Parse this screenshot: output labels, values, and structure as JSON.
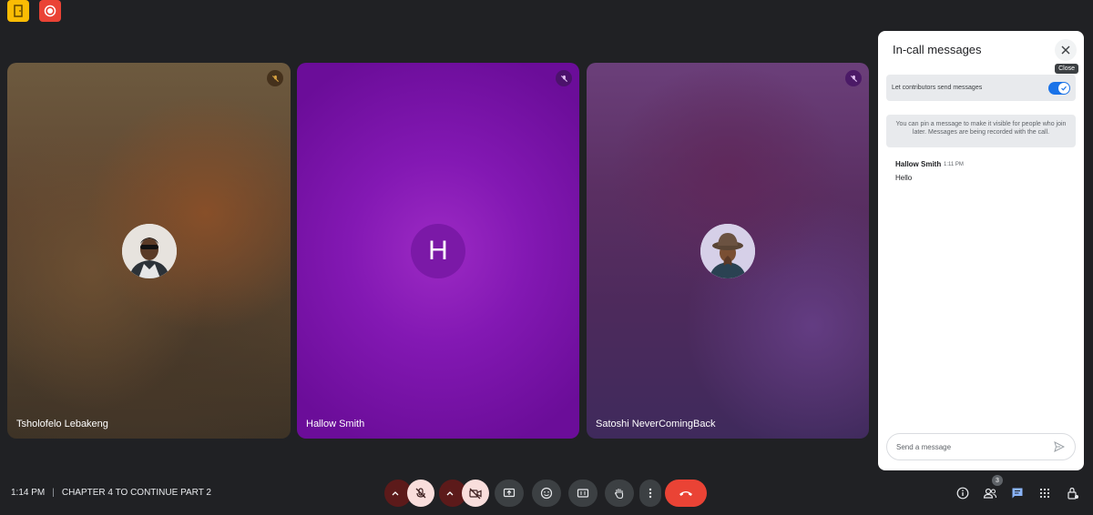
{
  "top_badges": [
    {
      "icon": "host-door-icon",
      "color": "#fbbc04"
    },
    {
      "icon": "record-icon",
      "color": "#ea4335"
    }
  ],
  "participants": [
    {
      "name": "Tsholofelo Lebakeng",
      "avatar": "photo",
      "muted": true
    },
    {
      "name": "Hallow Smith",
      "avatar_letter": "H",
      "muted": true
    },
    {
      "name": "Satoshi NeverComingBack",
      "avatar": "photo",
      "muted": true
    }
  ],
  "chat_panel": {
    "title": "In-call messages",
    "close_tooltip": "Close",
    "toggle_label": "Let contributors send messages",
    "toggle_on": true,
    "info_text": "You can pin a message to make it visible for people who join later. Messages are being recorded with the call.",
    "messages": [
      {
        "sender": "Hallow Smith",
        "time": "1:11 PM",
        "text": "Hello"
      }
    ],
    "input_placeholder": "Send a message"
  },
  "bottom_bar": {
    "time": "1:14 PM",
    "separator": "|",
    "meeting_title": "CHAPTER 4 TO CONTINUE PART 2",
    "people_count": "3",
    "accent_end_call": "#ea4335"
  }
}
